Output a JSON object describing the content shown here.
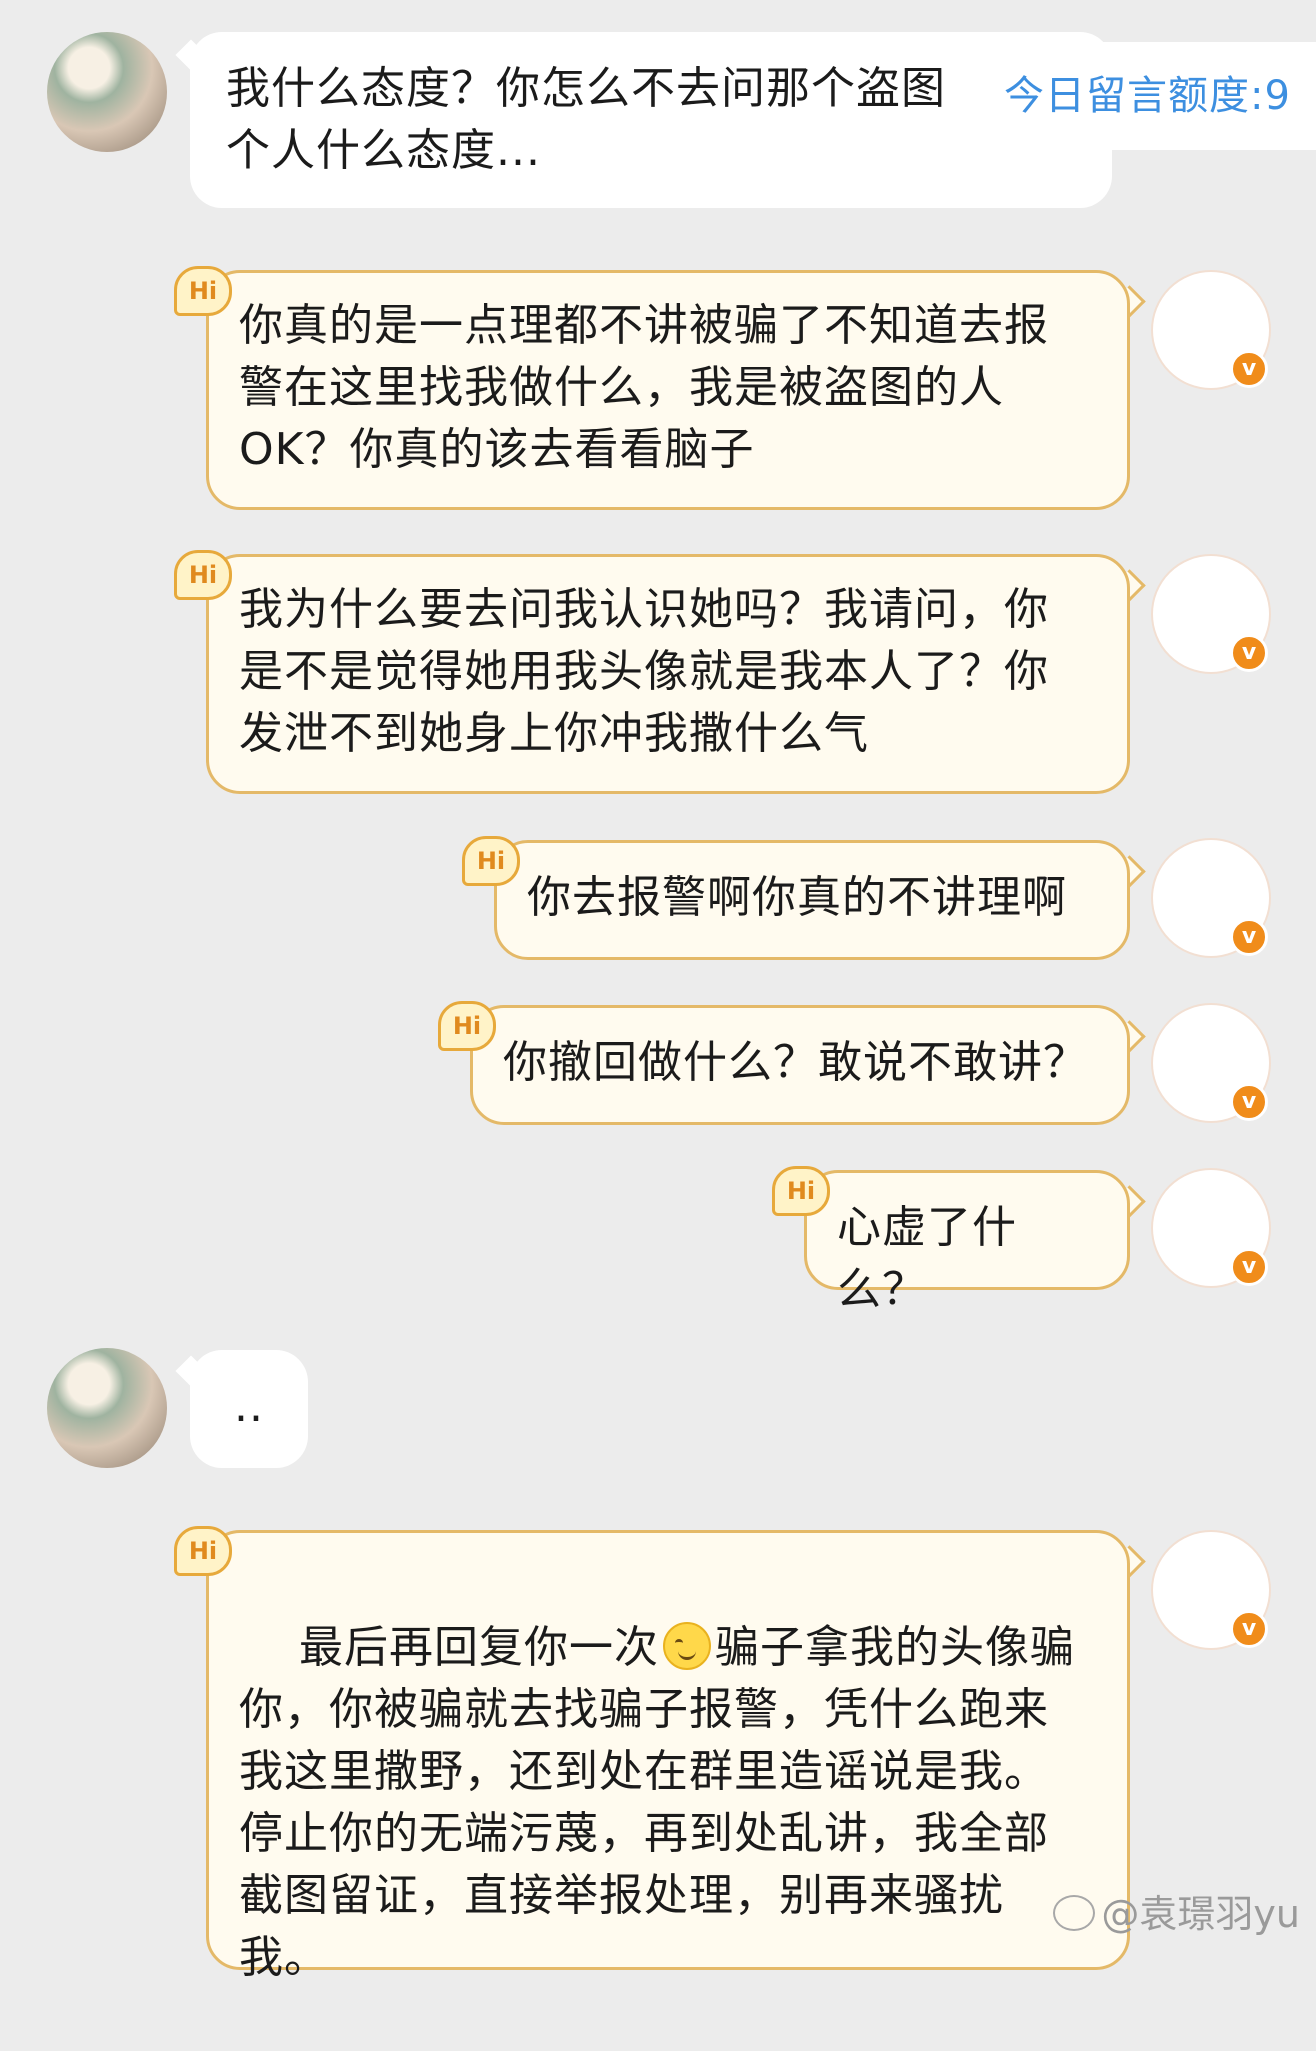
{
  "quota": {
    "label": "今日留言额度:9"
  },
  "messages": [
    {
      "side": "left",
      "text": "我什么态度？你怎么不去问那个盗图\n个人什么态度..."
    },
    {
      "side": "right",
      "text": "你真的是一点理都不讲被骗了不知道去报\n警在这里找我做什么，我是被盗图的人\nOK？你真的该去看看脑子"
    },
    {
      "side": "right",
      "text": "我为什么要去问我认识她吗？我请问，你\n是不是觉得她用我头像就是我本人了？你\n发泄不到她身上你冲我撒什么气"
    },
    {
      "side": "right",
      "text": "你去报警啊你真的不讲理啊"
    },
    {
      "side": "right",
      "text": "你撤回做什么？敢说不敢讲？"
    },
    {
      "side": "right",
      "text": "心虚了什么？"
    },
    {
      "side": "left",
      "text": ".."
    },
    {
      "side": "right",
      "text_before_emoji": "最后再回复你一次",
      "emoji": "smiling-face-emoji",
      "text_after_emoji": "骗子拿我的头像骗\n你，你被骗就去找骗子报警，凭什么跑来\n我这里撒野，还到处在群里造谣说是我。\n停止你的无端污蔑，再到处乱讲，我全部\n截图留证，直接举报处理，别再来骚扰\n我。"
    }
  ],
  "hi_badge": {
    "label": "Hi",
    "color": "#e7a93b"
  },
  "verified_badge": {
    "label": "v",
    "color": "#f08c1a"
  },
  "watermark": {
    "text": "@袁璟羽yu"
  },
  "colors": {
    "background": "#ececec",
    "bubble_left": "#ffffff",
    "bubble_right": "#fffbef",
    "bubble_right_border": "#e4b968",
    "quota_text": "#3d8fe0"
  }
}
